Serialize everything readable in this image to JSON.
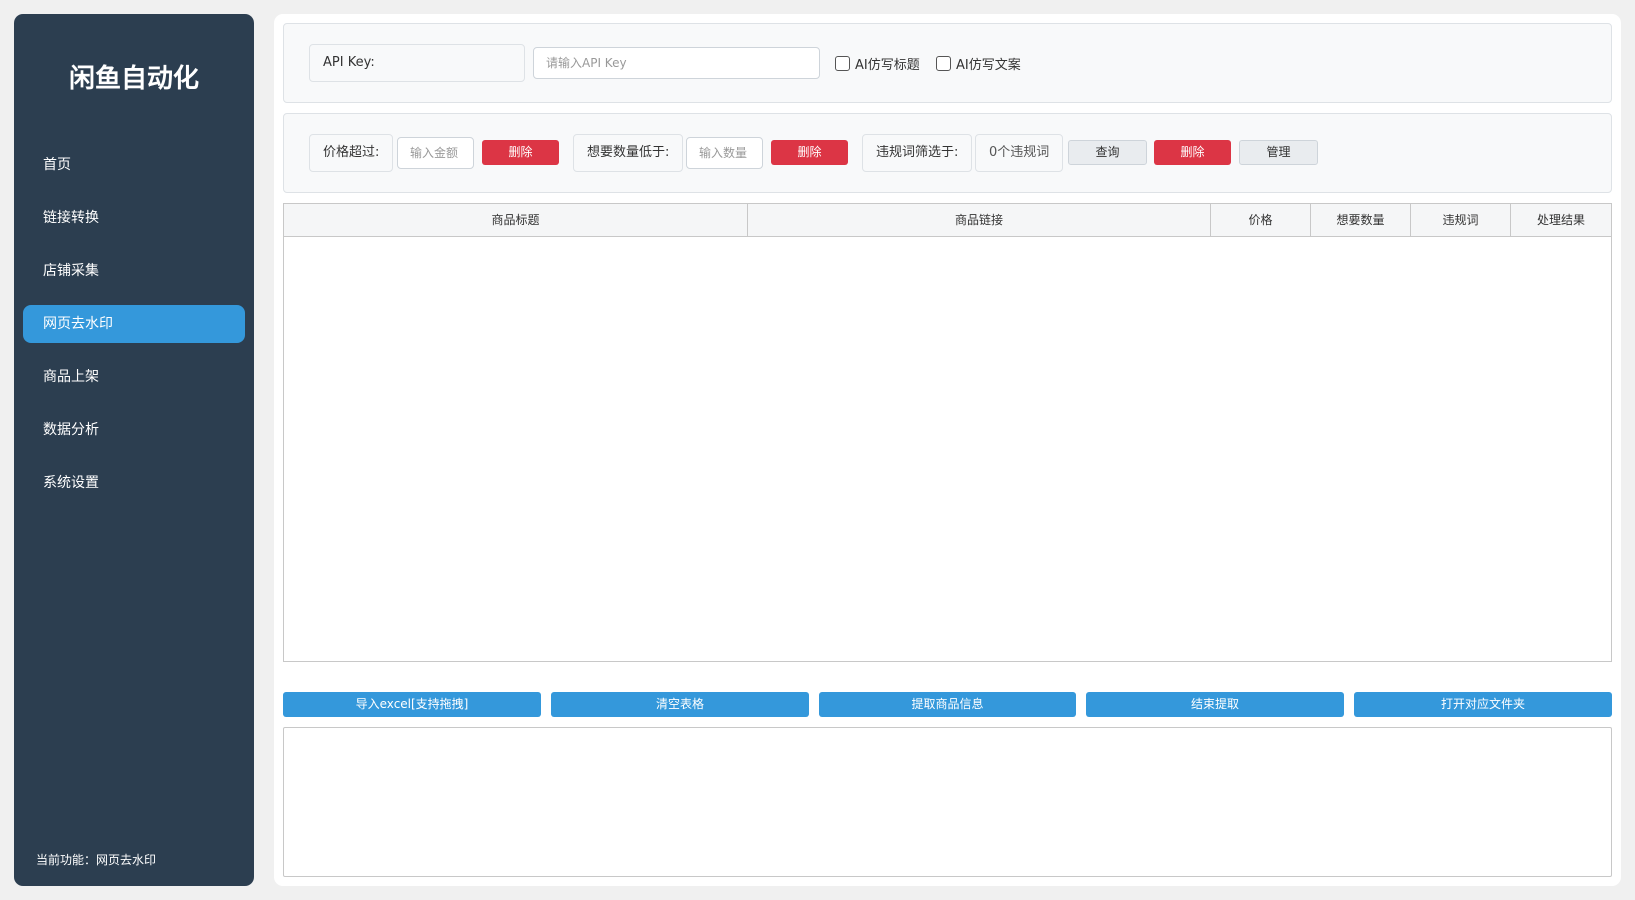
{
  "sidebar": {
    "title": "闲鱼自动化",
    "items": [
      {
        "label": "首页",
        "active": false
      },
      {
        "label": "链接转换",
        "active": false
      },
      {
        "label": "店铺采集",
        "active": false
      },
      {
        "label": "网页去水印",
        "active": true
      },
      {
        "label": "商品上架",
        "active": false
      },
      {
        "label": "数据分析",
        "active": false
      },
      {
        "label": "系统设置",
        "active": false
      }
    ],
    "status": "当前功能：网页去水印"
  },
  "api": {
    "label": "API Key:",
    "placeholder": "请输入API Key",
    "value": "",
    "ai_title_label": "AI仿写标题",
    "ai_title_checked": false,
    "ai_copy_label": "AI仿写文案",
    "ai_copy_checked": false
  },
  "filters": {
    "price_label": "价格超过:",
    "price_placeholder": "输入金额",
    "price_delete": "删除",
    "want_label": "想要数量低于:",
    "want_placeholder": "输入数量",
    "want_delete": "删除",
    "banned_label": "违规词筛选于:",
    "banned_count": "0个违规词",
    "query": "查询",
    "banned_delete": "删除",
    "manage": "管理"
  },
  "table": {
    "columns": [
      "商品标题",
      "商品链接",
      "价格",
      "想要数量",
      "违规词",
      "处理结果"
    ],
    "rows": []
  },
  "actions": {
    "import": "导入excel[支持拖拽]",
    "clear": "清空表格",
    "extract": "提取商品信息",
    "stop": "结束提取",
    "open_folder": "打开对应文件夹"
  },
  "colors": {
    "sidebar_bg": "#2c3e50",
    "accent": "#3498db",
    "danger": "#dc3545"
  }
}
